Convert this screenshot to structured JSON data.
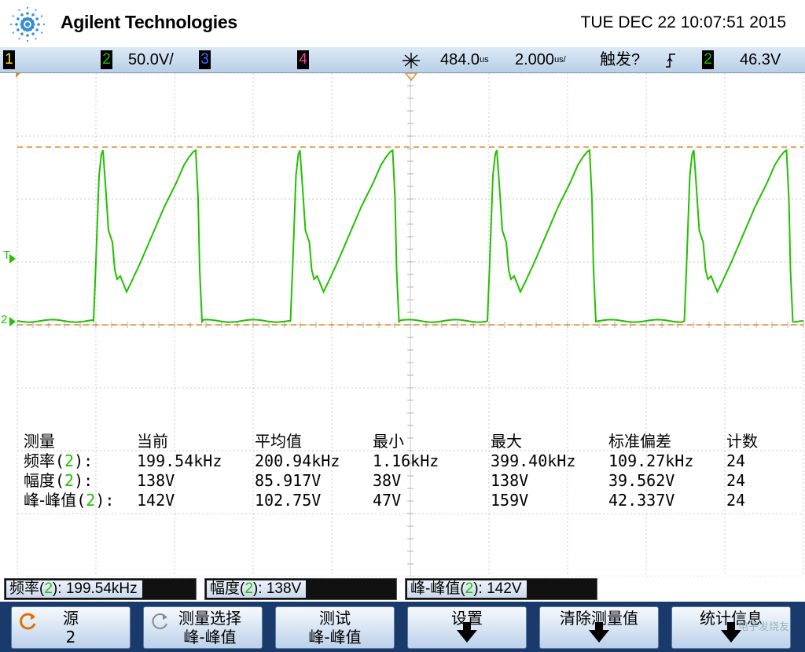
{
  "header": {
    "brand": "Agilent Technologies",
    "datetime": "TUE DEC 22 10:07:51 2015"
  },
  "status_bar": {
    "ch1_label": "1",
    "ch2_label": "2",
    "ch2_scale": "50.0V/",
    "ch3_label": "3",
    "ch4_label": "4",
    "time_delay": "484.0",
    "time_delay_unit": "us",
    "time_scale": "2.000",
    "time_scale_unit": "us/",
    "trigger_status": "触发?",
    "trigger_source": "2",
    "trigger_level": "46.3V"
  },
  "markers": {
    "trigger_marker": "T",
    "ground_marker": "2"
  },
  "colors": {
    "ch1": "#f0e020",
    "ch2": "#22c000",
    "ch3": "#3a6cff",
    "ch4": "#ff3aa0",
    "cursor": "#e08a2a",
    "grid": "#c8c8c8"
  },
  "measurements": {
    "headers": [
      "测量",
      "当前",
      "平均值",
      "最小",
      "最大",
      "标准偏差",
      "计数"
    ],
    "rows": [
      {
        "label": "频率",
        "source": "2",
        "current": "199.54kHz",
        "mean": "200.94kHz",
        "min": "1.16kHz",
        "max": "399.40kHz",
        "std": "109.27kHz",
        "count": "24"
      },
      {
        "label": "幅度",
        "source": "2",
        "current": "138V",
        "mean": "85.917V",
        "min": "38V",
        "max": "138V",
        "std": "39.562V",
        "count": "24"
      },
      {
        "label": "峰-峰值",
        "source": "2",
        "current": "142V",
        "mean": "102.75V",
        "min": "47V",
        "max": "159V",
        "std": "42.337V",
        "count": "24"
      }
    ]
  },
  "quick_measures": [
    {
      "label": "频率",
      "source": "2",
      "value": "199.54kHz"
    },
    {
      "label": "幅度",
      "source": "2",
      "value": "138V"
    },
    {
      "label": "峰-峰值",
      "source": "2",
      "value": "142V"
    }
  ],
  "softkeys": {
    "source_label": "源",
    "source_value": "2",
    "select_label": "测量选择",
    "select_value": "峰-峰值",
    "measure_label": "测试",
    "measure_value": "峰-峰值",
    "settings_label": "设置",
    "clear_label": "清除测量值",
    "stats_label": "统计信息"
  },
  "watermark": "电子发烧友"
}
